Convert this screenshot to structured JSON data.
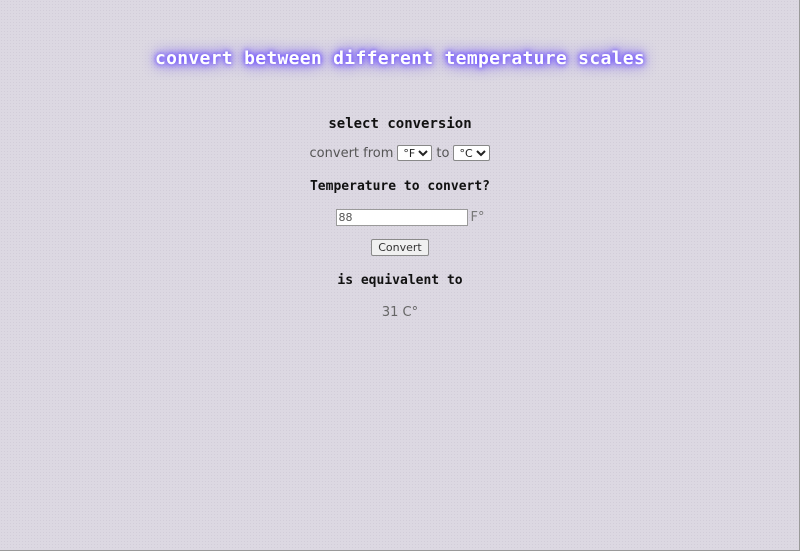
{
  "header": {
    "title": "convert between different temperature scales"
  },
  "conversion": {
    "heading": "select conversion",
    "from_label": "convert from",
    "from_unit": "°F",
    "to_label": "to",
    "to_unit": "°C"
  },
  "input": {
    "question": "Temperature to convert?",
    "value": "88",
    "unit_label": "F°"
  },
  "actions": {
    "convert_label": "Convert"
  },
  "result": {
    "heading": "is equivalent to",
    "value_text": "31 C°"
  },
  "colors": {
    "background": "#dcd8e2",
    "title_glow": "#6a4cff"
  }
}
